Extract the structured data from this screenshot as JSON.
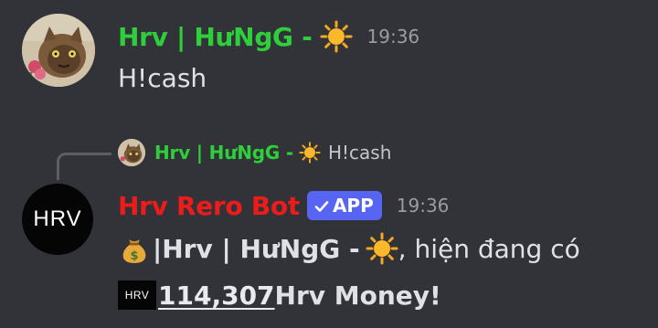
{
  "message1": {
    "author": "Hrv | HưNgG -",
    "timestamp": "19:36",
    "content": "H!cash",
    "author_color": "#2ecf3a",
    "status_icon": "sun-emoji"
  },
  "reply": {
    "author": "Hrv | HưNgG -",
    "content": "H!cash",
    "status_icon": "sun-emoji"
  },
  "message2": {
    "avatar_text": "HRV",
    "author": "Hrv Rero Bot",
    "author_color": "#ee1b1b",
    "badge": "APP",
    "badge_color": "#5865f2",
    "timestamp": "19:36",
    "line1_icon": "money-bag-emoji",
    "line1_prefix": "|Hrv | HưNgG -",
    "line1_suffix": ", hiện đang có",
    "line2_emoji_text": "HRV",
    "amount": "114,307",
    "currency": "Hrv Money!"
  }
}
